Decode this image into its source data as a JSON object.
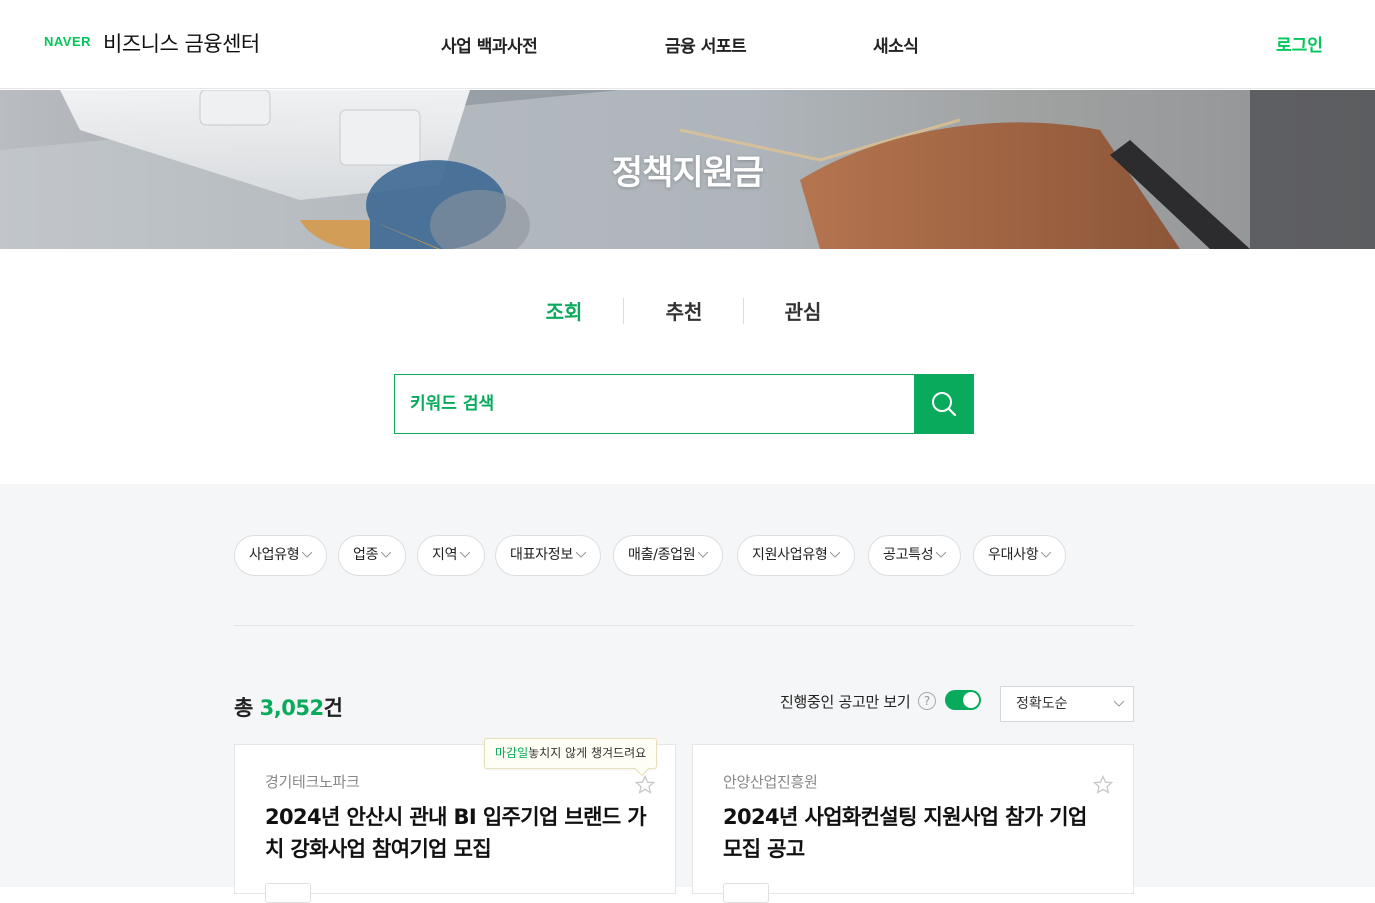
{
  "header": {
    "brand": "NAVER",
    "service_name": "비즈니스 금융센터",
    "nav": [
      "사업 백과사전",
      "금융 서포트",
      "새소식"
    ],
    "login": "로그인"
  },
  "hero": {
    "title": "정책지원금"
  },
  "tabs": [
    "조회",
    "추천",
    "관심"
  ],
  "active_tab": "조회",
  "search": {
    "placeholder": "키워드 검색",
    "button_icon": "search-icon"
  },
  "filters": [
    "사업유형",
    "업종",
    "지역",
    "대표자정보",
    "매출/종업원",
    "지원사업유형",
    "공고특성",
    "우대사항"
  ],
  "results": {
    "total_prefix": "총 ",
    "total_count": "3,052",
    "total_suffix": "건",
    "toggle_label": "진행중인 공고만 보기",
    "toggle_on": true,
    "sort_selected": "정확도순"
  },
  "tooltip": {
    "highlight": "마감일",
    "text": "놓치지 않게 챙겨드려요"
  },
  "cards": [
    {
      "org": "경기테크노파크",
      "title": "2024년 안산시 관내 BI 입주기업 브랜드 가치 강화사업 참여기업 모집"
    },
    {
      "org": "안양산업진흥원",
      "title": "2024년 사업화컨설팅 지원사업 참가 기업 모집 공고"
    }
  ],
  "colors": {
    "accent": "#09aa5c",
    "brand": "#03c75a",
    "background_gray": "#f5f6f7"
  }
}
